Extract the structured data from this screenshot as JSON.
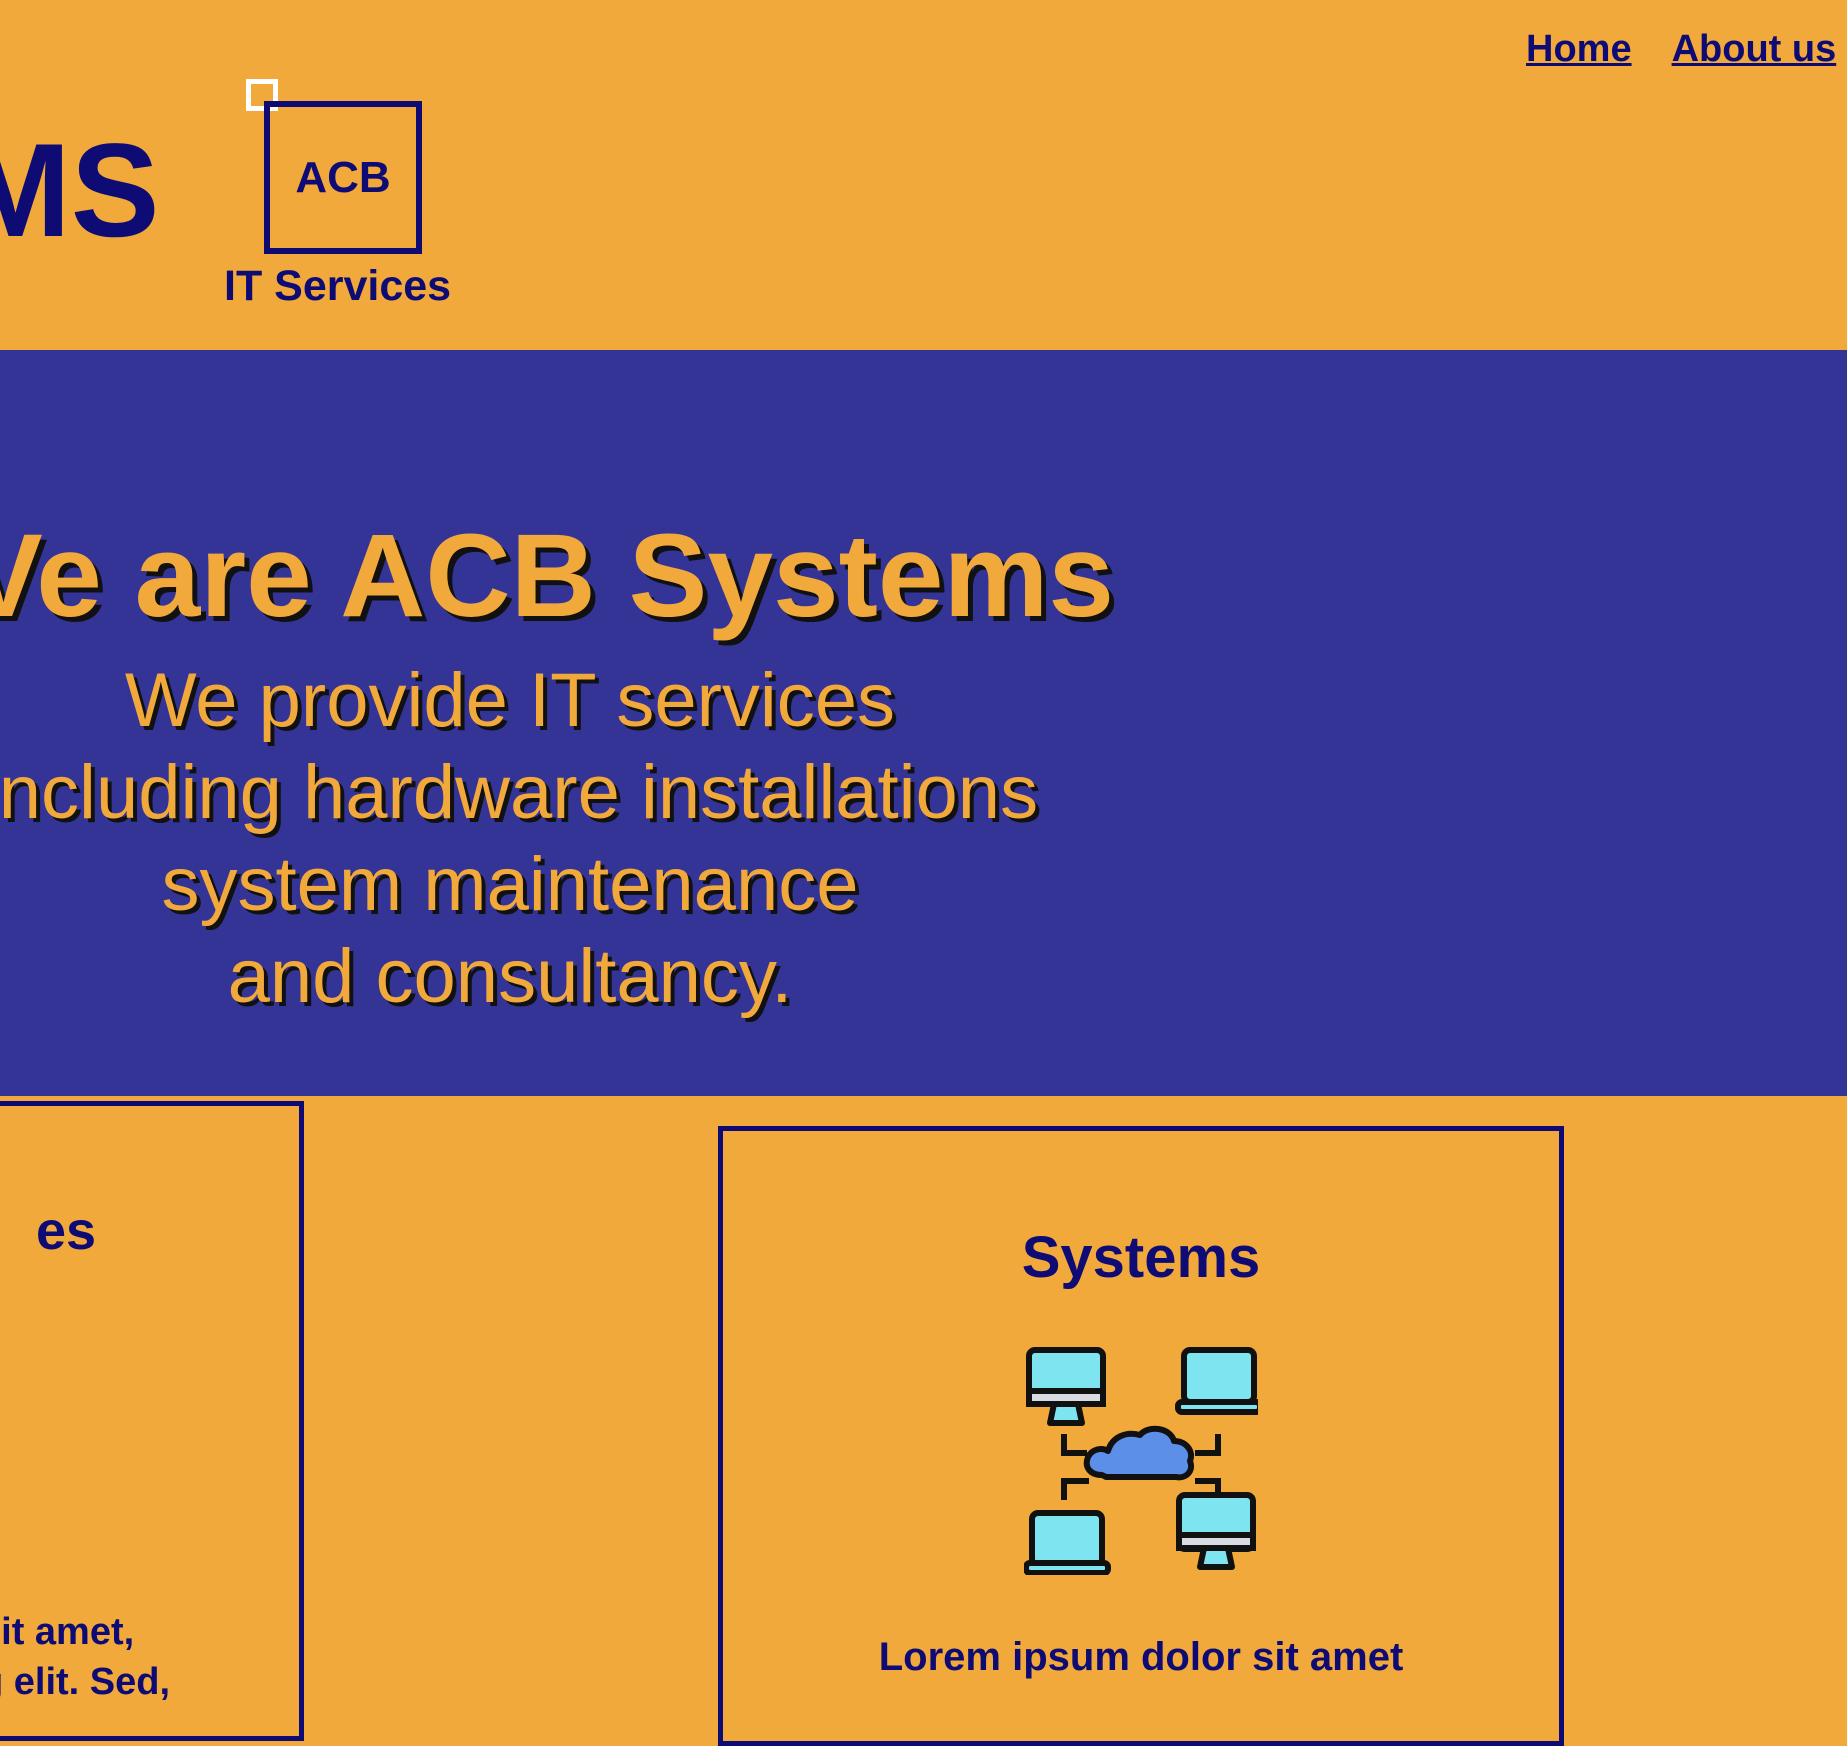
{
  "header": {
    "brand_partial": "MS",
    "logo_text": "ACB",
    "logo_caption": "IT Services",
    "nav": [
      "Home",
      "About us"
    ]
  },
  "hero": {
    "title": "Ve are ACB Systems",
    "lines": [
      "We provide IT services",
      "including hardware installations",
      "system maintenance",
      "and consultancy."
    ]
  },
  "cards": {
    "left": {
      "title_partial": "es",
      "desc_lines": [
        "sit amet,",
        "g elit. Sed,"
      ]
    },
    "right": {
      "title": "Systems",
      "icon": "network-cloud-icon",
      "desc_lines": [
        "Lorem ipsum dolor sit amet"
      ]
    }
  },
  "colors": {
    "orange": "#F2A93B",
    "navy": "#0E0C74",
    "hero_bg": "#343496",
    "screen": "#7EE5F0",
    "cloud": "#5B8FE8"
  }
}
